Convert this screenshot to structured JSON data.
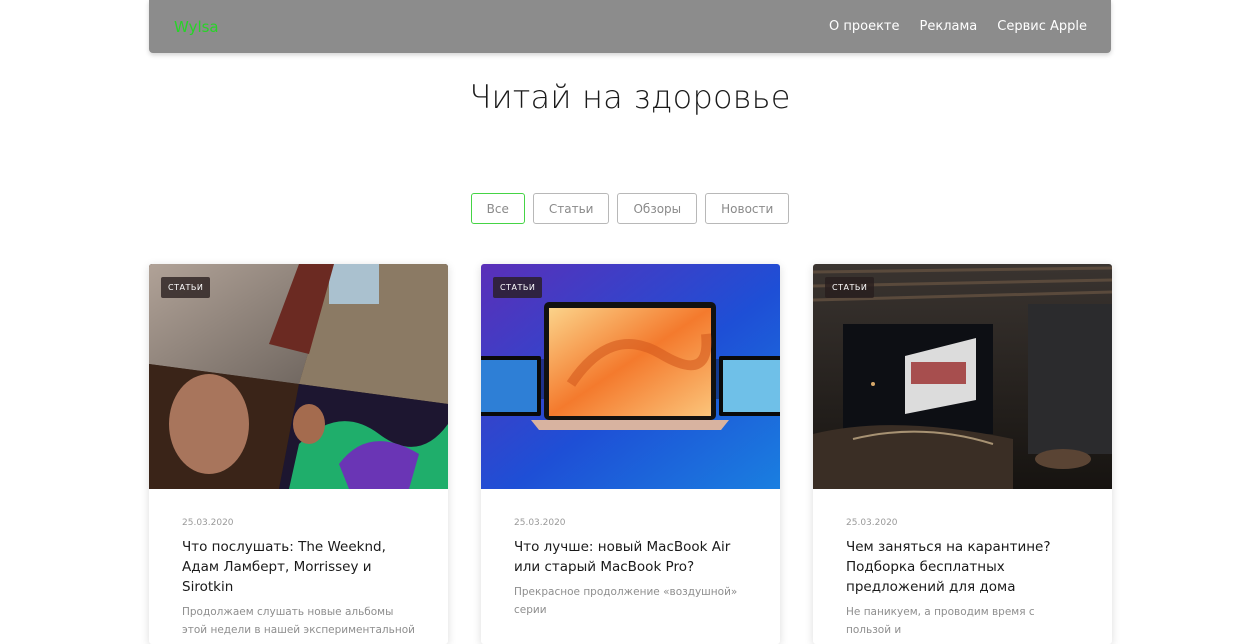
{
  "header": {
    "brand": "Wylsa",
    "nav": [
      "О проекте",
      "Реклама",
      "Сервис Apple"
    ]
  },
  "page": {
    "title": "Читай на здоровье"
  },
  "filters": [
    {
      "label": "Все",
      "active": true
    },
    {
      "label": "Статьи",
      "active": false
    },
    {
      "label": "Обзоры",
      "active": false
    },
    {
      "label": "Новости",
      "active": false
    }
  ],
  "cards": [
    {
      "tag": "СТАТЬИ",
      "date": "25.03.2020",
      "title": "Что послушать: The Weeknd, Адам Ламберт, Morrissey и Sirotkin",
      "excerpt": "Продолжаем слушать новые альбомы этой недели в нашей экспериментальной"
    },
    {
      "tag": "СТАТЬИ",
      "date": "25.03.2020",
      "title": "Что лучше: новый MacBook Air или старый MacBook  Pro?",
      "excerpt": "Прекрасное продолжение «воздушной» серии"
    },
    {
      "tag": "СТАТЬИ",
      "date": "25.03.2020",
      "title": "Чем заняться на карантине? Подборка бесплатных предложений для дома",
      "excerpt": "Не паникуем, а проводим время с пользой и"
    }
  ],
  "colors": {
    "brand": "#27d427",
    "navbar": "#8c8c8c",
    "active_filter_border": "#45d445"
  }
}
